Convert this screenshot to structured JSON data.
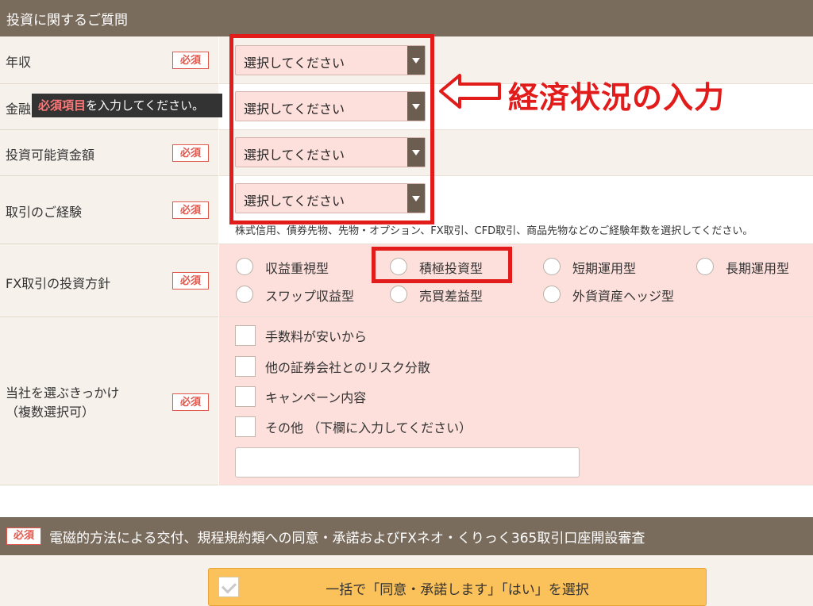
{
  "section_title": "投資に関するご質問",
  "required_badge": "必須",
  "rows": {
    "income": "年収",
    "financial": "金融",
    "investable": "投資可能資金額",
    "experience": "取引のご経験",
    "policy": "FX取引の投資方針",
    "reason_line1": "当社を選ぶきっかけ",
    "reason_line2": "（複数選択可）"
  },
  "select_placeholder": "選択してください",
  "tooltip": {
    "highlight": "必須項目",
    "rest": "を入力してください。"
  },
  "annotation": "経済状況の入力",
  "experience_note": "株式信用、債券先物、先物・オプション、FX取引、CFD取引、商品先物などのご経験年数を選択してください。",
  "policy_options": [
    "収益重視型",
    "積極投資型",
    "短期運用型",
    "長期運用型",
    "スワップ収益型",
    "売買差益型",
    "外貨資産ヘッジ型"
  ],
  "reason_options": [
    "手数料が安いから",
    "他の証券会社とのリスク分散",
    "キャンペーン内容",
    "その他 （下欄に入力してください）"
  ],
  "agreement_title": "電磁的方法による交付、規程規約類への同意・承諾およびFXネオ・くりっく365取引口座開設審査",
  "agree_all_button": "一括で「同意・承諾します」「はい」を選択",
  "colors": {
    "header": "#7a6c5d",
    "required": "#e2574c",
    "highlight_red": "#e21b1b",
    "field_pink": "#fde0dc",
    "button": "#fbc15a"
  }
}
